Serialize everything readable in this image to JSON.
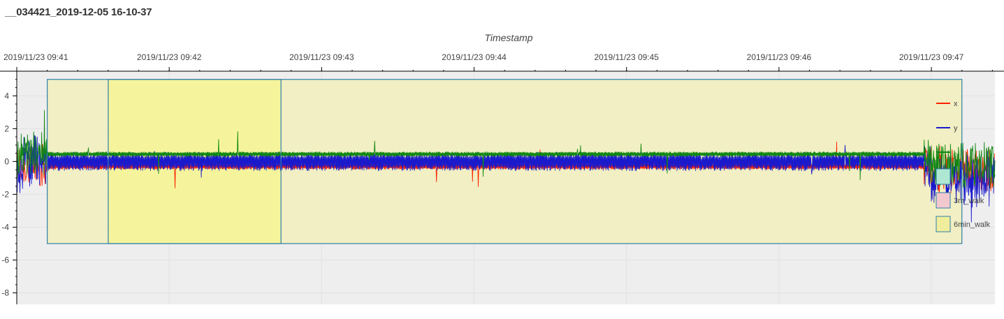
{
  "page": {
    "title": "__034421_2019-12-05 16-10-37"
  },
  "chart_data": {
    "type": "line",
    "title": "",
    "xlabel": "Timestamp",
    "ylabel": "",
    "x_axis_position": "top",
    "x_range": [
      "2019/11/23 09:41:00",
      "2019/11/23 09:47:25"
    ],
    "x_ticks": [
      "2019/11/23 09:41",
      "2019/11/23 09:42",
      "2019/11/23 09:43",
      "2019/11/23 09:44",
      "2019/11/23 09:45",
      "2019/11/23 09:46",
      "2019/11/23 09:47"
    ],
    "ylim": [
      -8.7,
      5.5
    ],
    "y_ticks": [
      -8,
      -6,
      -4,
      -2,
      0,
      2,
      4
    ],
    "y_tick_labels": [
      "-8",
      "-6",
      "-4",
      "-2",
      "0",
      "2",
      "4"
    ],
    "grid": true,
    "background": "#eeeeee",
    "legend_position": "right",
    "series": [
      {
        "name": "x",
        "color": "#ff2200",
        "approx_baseline": -0.5,
        "oscillation": 0.25
      },
      {
        "name": "y",
        "color": "#1a1acc",
        "approx_baseline": -1.0,
        "oscillation": 0.8
      },
      {
        "name": "",
        "color": "#118811",
        "approx_baseline": -0.25,
        "oscillation": 0.2
      }
    ],
    "events": [
      {
        "start": "2019/11/23 09:41",
        "end": "2019/11/23 09:47",
        "values": [
          0.2,
          1.0,
          0.7,
          0.7,
          0.2
        ]
      },
      {
        "start": "2019/11/23 09:43",
        "end": "2019/11/23 09:43",
        "values": [
          0.6,
          1.0,
          0.3
        ]
      },
      {
        "start": "2019/11/23 09:44",
        "end": "2019/11/23 09:44",
        "values": [
          0.3,
          1.0,
          0.4
        ]
      },
      {
        "start": "2019/11/23 09:45",
        "end": "2019/11/23 09:45",
        "values": [
          0.3,
          1.0,
          0.3
        ]
      }
    ],
    "regions": [
      {
        "label": "6min_walk",
        "start": "2019/11/23 09:41:12",
        "end": "2019/11/23 09:47:12",
        "y_range": [
          -5,
          5
        ],
        "fill": "#f0eec0",
        "stroke": "#2e7fa8"
      },
      {
        "label": "",
        "start": "2019/11/23 09:41:36",
        "end": "2019/11/23 09:42:44",
        "y_range": [
          -5,
          5
        ],
        "fill": "#f4f39a",
        "stroke": "#2e7fa8"
      }
    ],
    "legend": [
      {
        "label": "x",
        "kind": "line",
        "color": "#ff2200"
      },
      {
        "label": "y",
        "kind": "line",
        "color": "#1a1acc"
      },
      {
        "label": "",
        "kind": "line",
        "color": "#118811"
      },
      {
        "label": "",
        "kind": "box",
        "color": "#aee8d2",
        "stroke": "#2e7fa8"
      },
      {
        "label": "3m_walk",
        "kind": "box",
        "color": "#f2c8cf",
        "stroke": "#2e7fa8"
      },
      {
        "label": "6min_walk",
        "kind": "box",
        "color": "#f0ee9c",
        "stroke": "#2e7fa8"
      }
    ]
  }
}
